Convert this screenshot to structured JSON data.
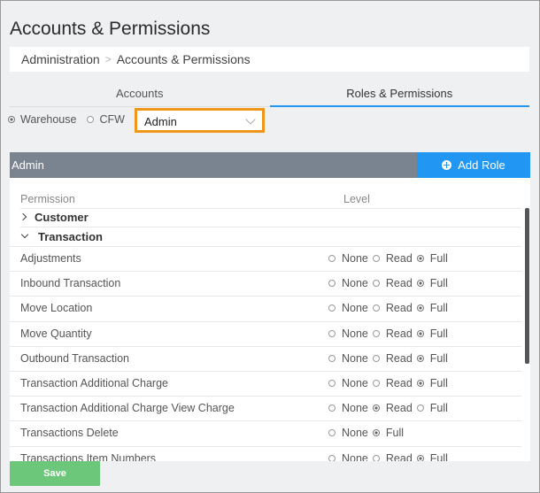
{
  "page": {
    "title": "Accounts & Permissions"
  },
  "breadcrumb": {
    "items": [
      "Administration",
      "Accounts & Permissions"
    ],
    "separator": ">"
  },
  "tabs": [
    {
      "label": "Accounts",
      "active": false
    },
    {
      "label": "Roles & Permissions",
      "active": true
    }
  ],
  "scope": {
    "options": [
      {
        "label": "Warehouse",
        "selected": true
      },
      {
        "label": "CFW",
        "selected": false
      }
    ]
  },
  "role_select": {
    "value": "Admin"
  },
  "role_bar": {
    "name": "Admin",
    "add_label": "Add Role"
  },
  "table": {
    "col_permission": "Permission",
    "col_level": "Level",
    "groups": [
      {
        "label": "Customer",
        "expanded": false
      },
      {
        "label": "Transaction",
        "expanded": true
      }
    ],
    "rows": [
      {
        "name": "Adjustments",
        "options": [
          "None",
          "Read",
          "Full"
        ],
        "selected": "Full"
      },
      {
        "name": "Inbound Transaction",
        "options": [
          "None",
          "Read",
          "Full"
        ],
        "selected": "Full"
      },
      {
        "name": "Move Location",
        "options": [
          "None",
          "Read",
          "Full"
        ],
        "selected": "Full"
      },
      {
        "name": "Move Quantity",
        "options": [
          "None",
          "Read",
          "Full"
        ],
        "selected": "Full"
      },
      {
        "name": "Outbound Transaction",
        "options": [
          "None",
          "Read",
          "Full"
        ],
        "selected": "Full"
      },
      {
        "name": "Transaction Additional Charge",
        "options": [
          "None",
          "Read",
          "Full"
        ],
        "selected": "Full"
      },
      {
        "name": "Transaction Additional Charge View Charge",
        "options": [
          "None",
          "Read",
          "Full"
        ],
        "selected": "Read"
      },
      {
        "name": "Transactions Delete",
        "options": [
          "None",
          "Full"
        ],
        "selected": "Full"
      },
      {
        "name": "Transactions Item Numbers",
        "options": [
          "None",
          "Read",
          "Full"
        ],
        "selected": "Full"
      }
    ]
  },
  "footer": {
    "save_label": "Save"
  },
  "colors": {
    "accent": "#2196f3",
    "highlight": "#f0961b",
    "role_bar": "#7a8491",
    "save": "#6cc77a"
  }
}
